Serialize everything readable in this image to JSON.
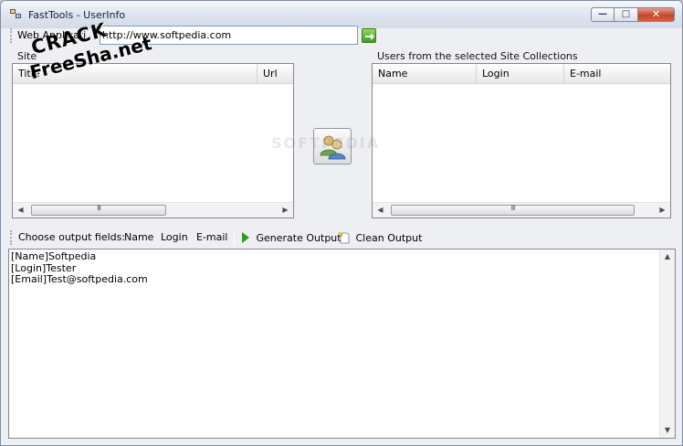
{
  "window": {
    "title": "FastTools - UserInfo"
  },
  "urlbar": {
    "label": "Web Applicati",
    "url_value": "http://www.softpedia.com"
  },
  "sites_panel": {
    "label": "Site",
    "columns": [
      "Title",
      "Url"
    ]
  },
  "users_panel": {
    "label": "Users from the selected Site Collections",
    "columns": [
      "Name",
      "Login",
      "E-mail"
    ]
  },
  "toolbar": {
    "choose_label": "Choose output fields:",
    "field_name": "Name",
    "field_login": "Login",
    "field_email": "E-mail",
    "generate_label": "Generate Output",
    "clean_label": "Clean Output"
  },
  "output": {
    "lines": "[Name]Softpedia\n[Login]Tester\n[Email]Test@softpedia.com"
  },
  "watermark": {
    "line1": "CRACK",
    "line2": "FreeSha.net"
  },
  "background_mark": "SOFTPEDIA",
  "colors": {
    "accent_go": "#3e9c1f",
    "close_button": "#c6452b"
  }
}
